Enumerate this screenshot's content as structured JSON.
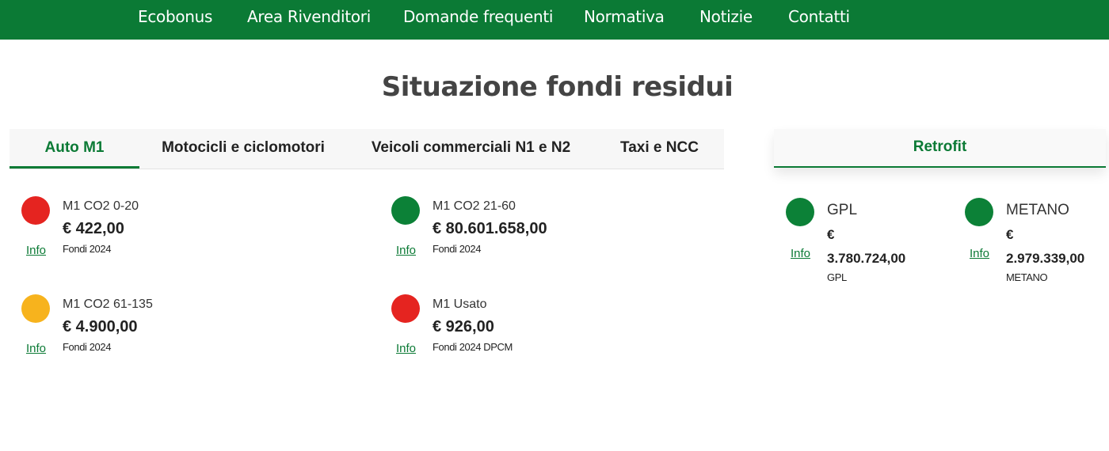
{
  "nav": {
    "items": [
      {
        "label": "Ecobonus"
      },
      {
        "label": "Area Rivenditori"
      },
      {
        "label": "Domande frequenti"
      },
      {
        "label": "Normativa"
      },
      {
        "label": "Notizie"
      },
      {
        "label": "Contatti"
      }
    ]
  },
  "page": {
    "title": "Situazione fondi residui"
  },
  "tabs": {
    "active": "Auto M1",
    "items": [
      {
        "label": "Auto M1"
      },
      {
        "label": "Motocicli e ciclomotori"
      },
      {
        "label": "Veicoli commerciali N1 e N2"
      },
      {
        "label": "Taxi e NCC"
      }
    ]
  },
  "funds": [
    {
      "name": "M1 CO2 0-20",
      "amount": "€ 422,00",
      "sub": "Fondi 2024",
      "status": "red",
      "info": "Info"
    },
    {
      "name": "M1 CO2 21-60",
      "amount": "€ 80.601.658,00",
      "sub": "Fondi 2024",
      "status": "green",
      "info": "Info"
    },
    {
      "name": "M1 CO2 61-135",
      "amount": "€ 4.900,00",
      "sub": "Fondi 2024",
      "status": "yellow",
      "info": "Info"
    },
    {
      "name": "M1 Usato",
      "amount": "€ 926,00",
      "sub": "Fondi 2024 DPCM",
      "status": "red",
      "info": "Info"
    }
  ],
  "retrofit": {
    "tab_label": "Retrofit",
    "items": [
      {
        "name": "GPL",
        "currency": "€",
        "amount": "3.780.724,00",
        "sub": "GPL",
        "status": "green",
        "info": "Info"
      },
      {
        "name": "METANO",
        "currency": "€",
        "amount": "2.979.339,00",
        "sub": "METANO",
        "status": "green",
        "info": "Info"
      }
    ]
  },
  "colors": {
    "brand": "#0b7a35",
    "status_red": "#e52420",
    "status_green": "#0c8137",
    "status_yellow": "#f7b31d"
  },
  "icons": {
    "status_indicator": "circle-status-icon"
  }
}
